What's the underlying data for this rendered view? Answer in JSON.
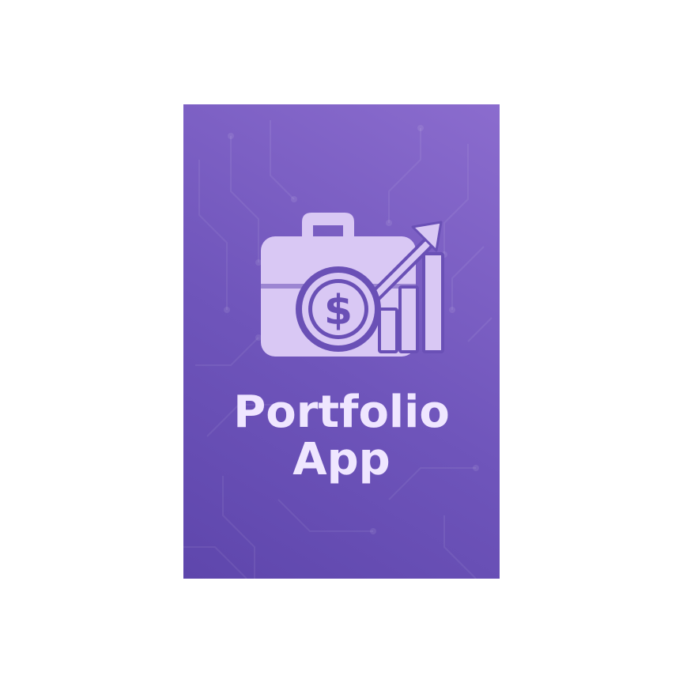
{
  "app_name": {
    "line1": "Portfolio",
    "line2": "App"
  },
  "icons": {
    "main": "briefcase-dollar-growth-icon",
    "briefcase": "briefcase-icon",
    "coin": "dollar-coin-icon",
    "chart": "bar-chart-icon",
    "arrow": "trend-up-arrow-icon"
  },
  "colors": {
    "background_start": "#5e46ac",
    "background_end": "#8b6cce",
    "icon_fill": "#d9c8f4",
    "icon_shade": "#c9b4ee",
    "outline": "#6a50b6",
    "text": "#efe6ff"
  }
}
